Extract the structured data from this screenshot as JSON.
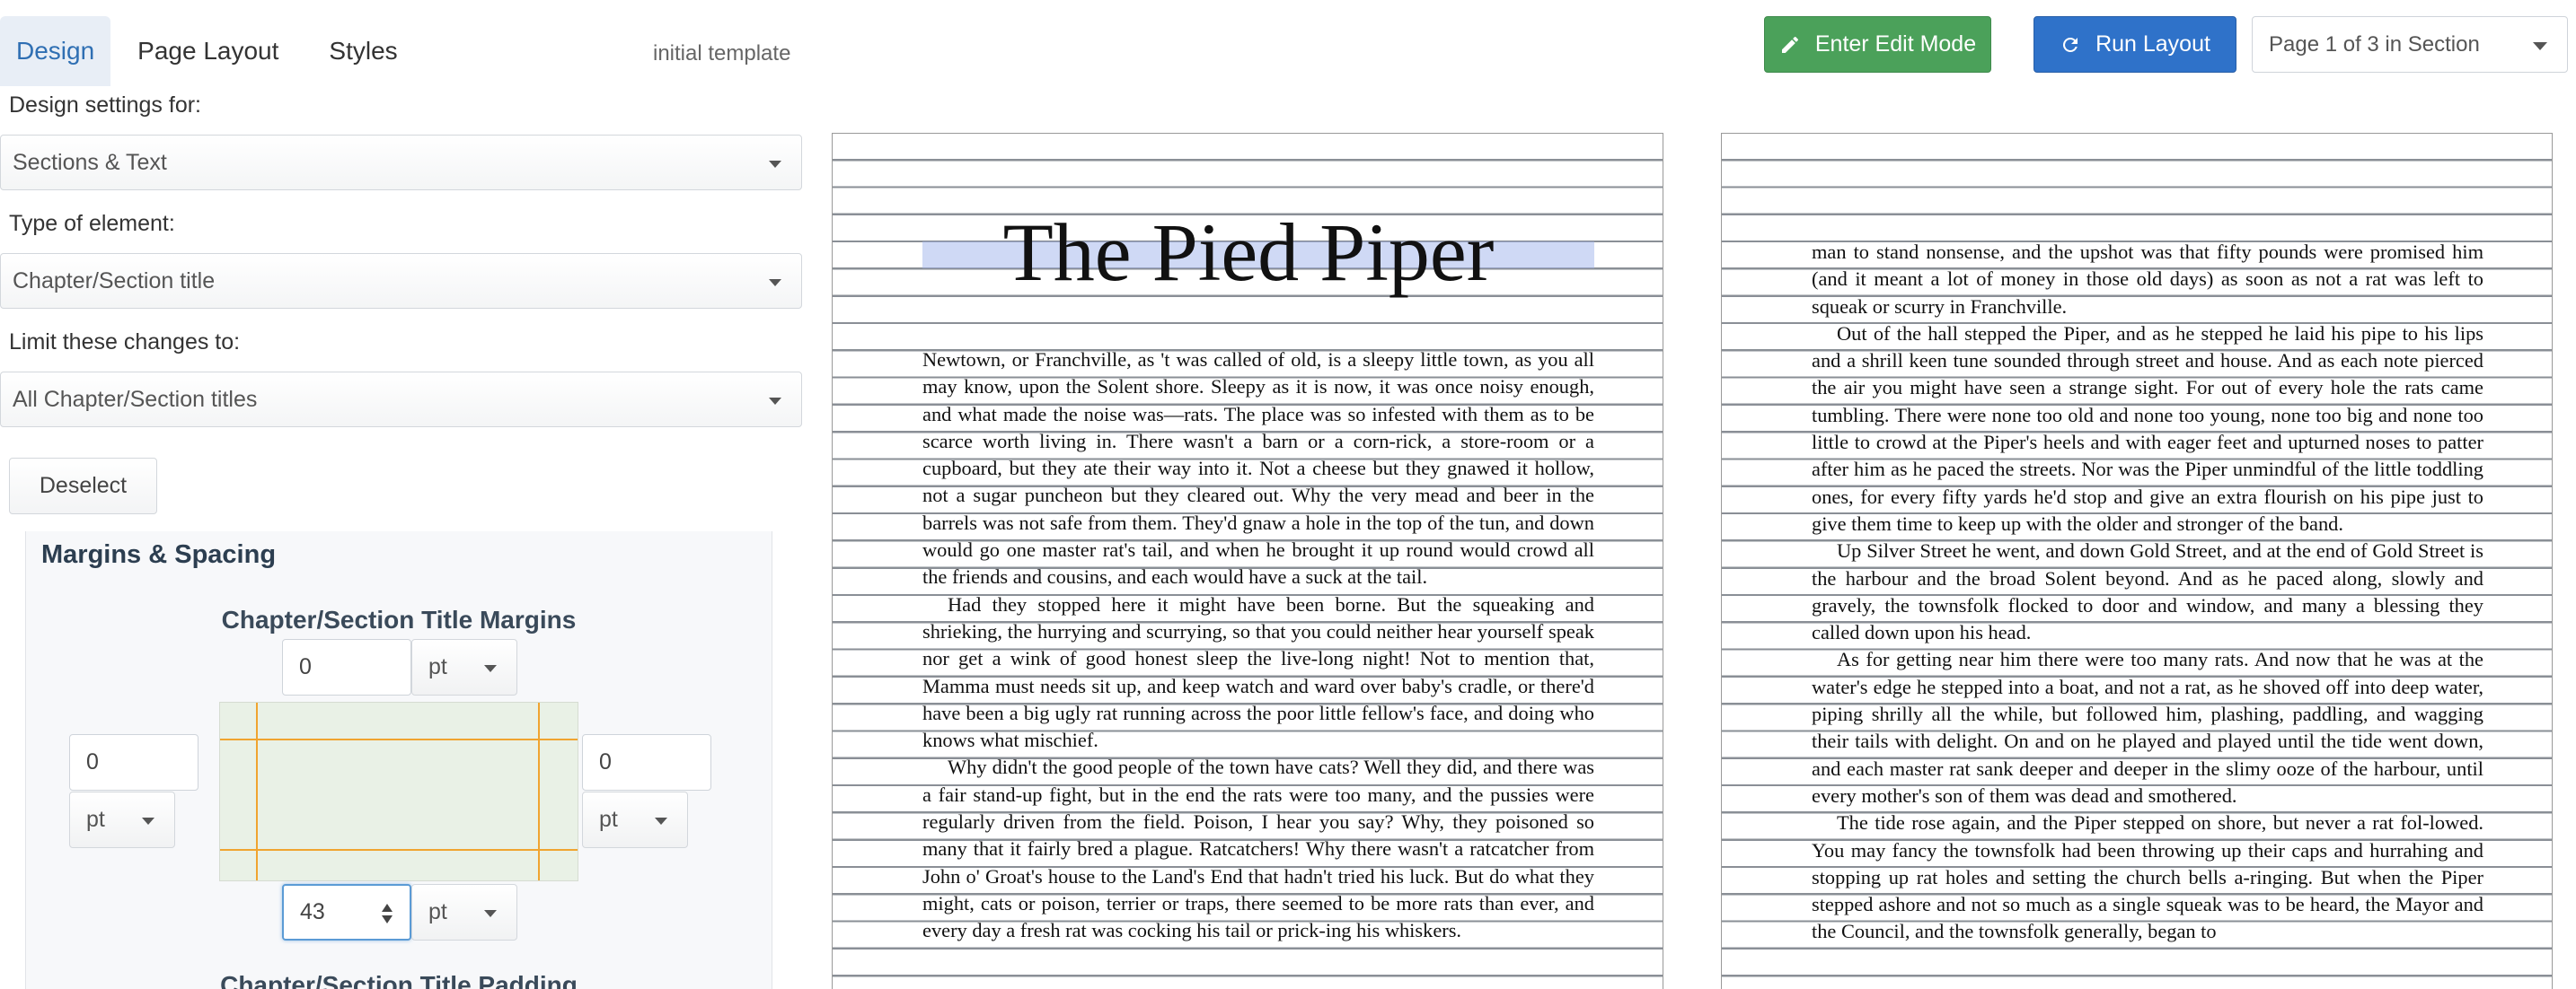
{
  "tabs": [
    {
      "label": "Design",
      "active": true
    },
    {
      "label": "Page Layout",
      "active": false
    },
    {
      "label": "Styles",
      "active": false
    }
  ],
  "template_label": "initial template",
  "toolbar": {
    "edit_label": "Enter Edit Mode",
    "run_label": "Run Layout",
    "page_selector": "Page 1 of 3 in Section",
    "edit_icon": "pencil-icon",
    "run_icon": "refresh-icon"
  },
  "design": {
    "settings_label": "Design settings for:",
    "settings_value": "Sections & Text",
    "element_label": "Type of element:",
    "element_value": "Chapter/Section title",
    "limit_label": "Limit these changes to:",
    "limit_value": "All Chapter/Section titles",
    "deselect_label": "Deselect"
  },
  "margins": {
    "section_title": "Margins & Spacing",
    "subtitle": "Chapter/Section Title Margins",
    "top": {
      "value": "0",
      "unit": "pt"
    },
    "left": {
      "value": "0",
      "unit": "pt"
    },
    "right": {
      "value": "0",
      "unit": "pt"
    },
    "bottom": {
      "value": "43",
      "unit": "pt"
    },
    "padding_title": "Chapter/Section Title Padding"
  },
  "document": {
    "title": "The Pied Piper",
    "left_paragraphs": [
      "Newtown, or Franchville, as 't was called of old, is a sleepy little town, as you all may know, upon the Solent shore. Sleepy as it is now, it was once noisy enough, and what made the noise was—rats. The place was so infested with them as to be scarce worth living in. There wasn't a barn or a corn-rick, a store-room or a cupboard, but they ate their way into it. Not a cheese but they gnawed it hollow, not a sugar puncheon but they cleared out. Why the very mead and beer in the barrels was not safe from them. They'd gnaw a hole in the top of the tun, and down would go one master rat's tail, and when he brought it up round would crowd all the friends and cousins, and each would have a suck at the tail.",
      "Had they stopped here it might have been borne. But the squeaking and shrieking, the hurrying and scurrying, so that you could neither hear yourself speak nor get a wink of good honest sleep the live-long night! Not to mention that, Mamma must needs sit up, and keep watch and ward over baby's cradle, or there'd have been a big ugly rat running across the poor little fellow's face, and doing who knows what mischief.",
      "Why didn't the good people of the town have cats? Well they did, and there was a fair stand-up fight, but in the end the rats were too many, and the pussies were regularly driven from the field. Poison, I hear you say? Why, they poisoned so many that it fairly bred a plague. Ratcatchers! Why there wasn't a ratcatcher from John o' Groat's house to the Land's End that hadn't tried his luck. But do what they might, cats or poison, terrier or traps, there seemed to be more rats than ever, and every day a fresh rat was cocking his tail or prick-ing his whiskers."
    ],
    "right_paragraphs": [
      "man to stand nonsense, and the upshot was that fifty pounds were promised him (and it meant a lot of money in those old days) as soon as not a rat was left to squeak or scurry in Franchville.",
      "Out of the hall stepped the Piper, and as he stepped he laid his pipe to his lips and a shrill keen tune sounded through street and house. And as each note pierced the air you might have seen a strange sight. For out of every hole the rats came tumbling. There were none too old and none too young, none too big and none too little to crowd at the Piper's heels and with eager feet and upturned noses to patter after him as he paced the streets. Nor was the Piper unmindful of the little toddling ones, for every fifty yards he'd stop and give an extra flourish on his pipe just to give them time to keep up with the older and stronger of the band.",
      "Up Silver Street he went, and down Gold Street, and at the end of Gold Street is the harbour and the broad Solent beyond. And as he paced along, slowly and gravely, the townsfolk flocked to door and window, and many a blessing they called down upon his head.",
      "As for getting near him there were too many rats. And now that he was at the water's edge he stepped into a boat, and not a rat, as he shoved off into deep water, piping shrilly all the while, but followed him, plashing, paddling, and wagging their tails with delight. On and on he played and played until the tide went down, and each master rat sank deeper and deeper in the slimy ooze of the harbour, until every mother's son of them was dead and smothered.",
      "The tide rose again, and the Piper stepped on shore, but never a rat fol-lowed. You may fancy the townsfolk had been throwing up their caps and hurrahing and stopping up rat holes and setting the church bells a-ringing. But when the Piper stepped ashore and not so much as a single squeak was to be heard, the Mayor and the Council, and the townsfolk generally, began to"
    ]
  }
}
